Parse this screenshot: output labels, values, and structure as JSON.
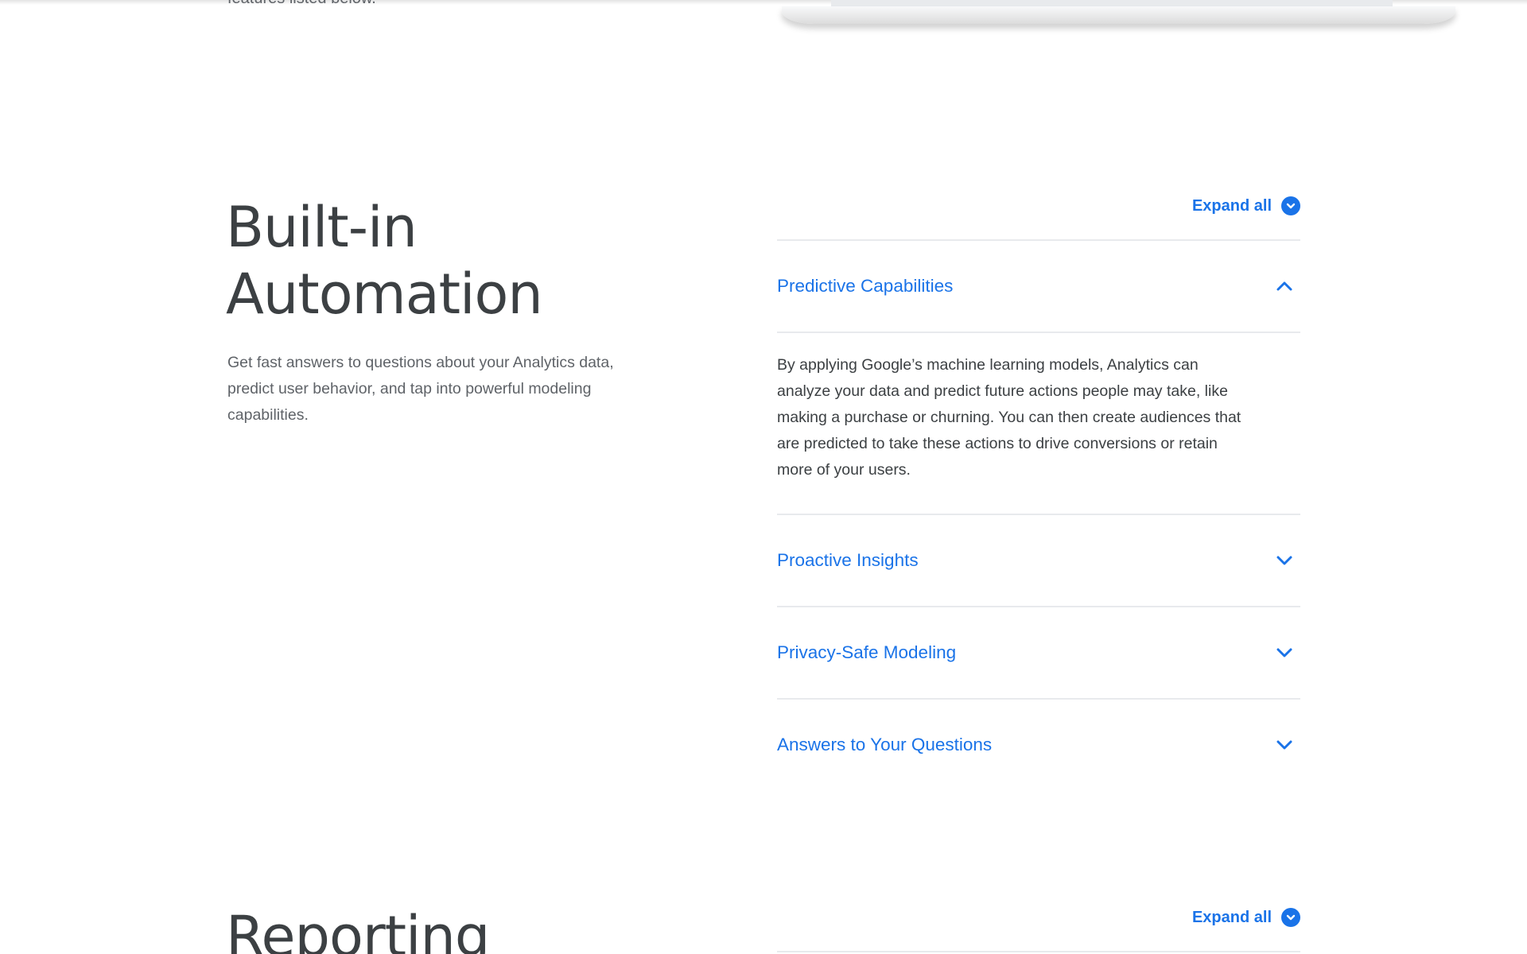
{
  "top": {
    "cut_text": "features listed below."
  },
  "section": {
    "title_line1": "Built-in",
    "title_line2": "Automation",
    "description": "Get fast answers to questions about your Analytics data, predict user behavior, and tap into powerful modeling capabilities.",
    "expand_all_label": "Expand all",
    "expand_icon": "chevron-down-circle-icon",
    "items": [
      {
        "title": "Predictive Capabilities",
        "expanded": true,
        "icon": "chevron-up-icon",
        "body": "By applying Google’s machine learning models, Analytics can analyze your data and predict future actions people may take, like making a purchase or churning. You can then create audiences that are predicted to take these actions to drive conversions or retain more of your users."
      },
      {
        "title": "Proactive Insights",
        "expanded": false,
        "icon": "chevron-down-icon"
      },
      {
        "title": "Privacy-Safe Modeling",
        "expanded": false,
        "icon": "chevron-down-icon"
      },
      {
        "title": "Answers to Your Questions",
        "expanded": false,
        "icon": "chevron-down-icon"
      }
    ]
  },
  "next_section": {
    "title": "Reporting",
    "expand_all_label": "Expand all"
  },
  "colors": {
    "accent": "#1a73e8",
    "heading": "#3c4043",
    "body_text": "#5f6368",
    "divider": "#e8eaed"
  }
}
